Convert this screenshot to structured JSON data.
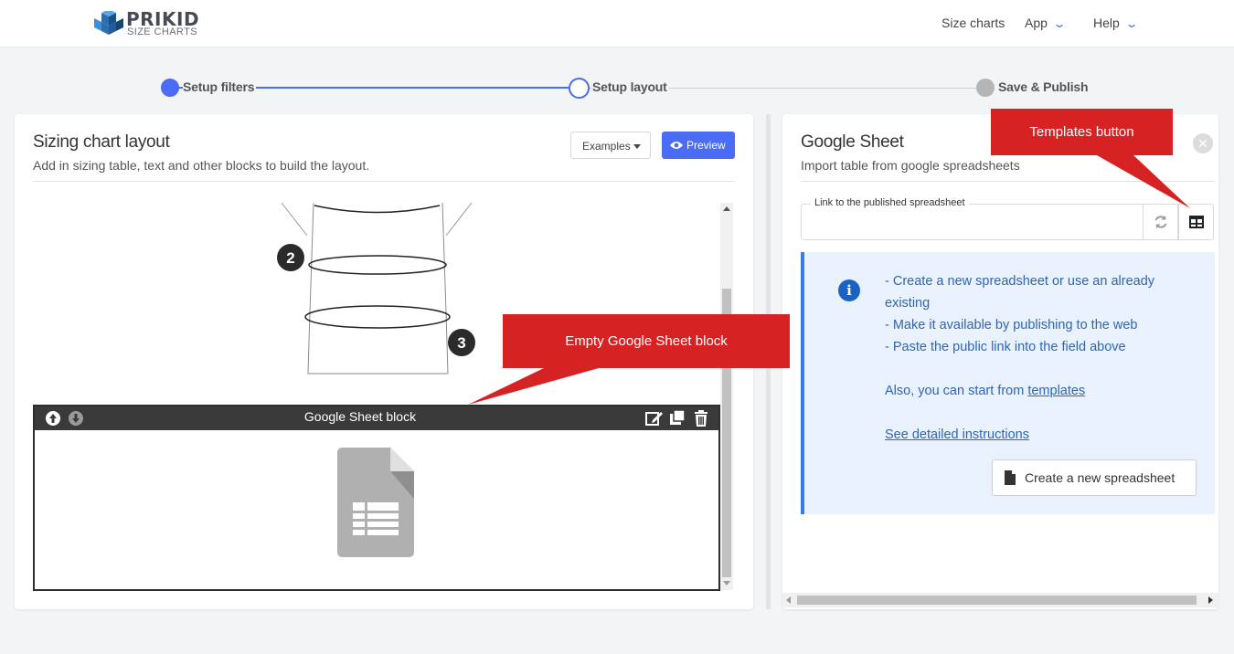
{
  "brand": {
    "name": "PRIKID",
    "tagline": "SIZE CHARTS"
  },
  "nav": {
    "size_charts": "Size charts",
    "app": "App",
    "help": "Help"
  },
  "stepper": {
    "steps": [
      {
        "label": "Setup filters",
        "state": "completed"
      },
      {
        "label": "Setup layout",
        "state": "current"
      },
      {
        "label": "Save & Publish",
        "state": "pending"
      }
    ],
    "colors": {
      "active": "#4a6cf7",
      "inactive": "#b5b5b5"
    }
  },
  "left_panel": {
    "title": "Sizing chart layout",
    "subtitle": "Add in sizing table, text and other blocks to build the layout.",
    "examples_label": "Examples",
    "preview_label": "Preview",
    "illustration_markers": [
      "2",
      "3"
    ],
    "block": {
      "title": "Google Sheet block"
    }
  },
  "right_panel": {
    "title": "Google Sheet",
    "subtitle": "Import table from google spreadsheets",
    "field": {
      "label": "Link to the published spreadsheet",
      "value": "",
      "placeholder": ""
    },
    "info": {
      "line1": "- Create a new spreadsheet or use an already existing",
      "line2": "- Make it available by publishing to the web",
      "line3": "- Paste the public link into the field above",
      "templates_prefix": "Also, you can start from",
      "templates_link": "templates",
      "instructions_link": "See detailed instructions"
    },
    "create_button": "Create a new spreadsheet"
  },
  "callouts": {
    "templates": "Templates button",
    "empty_block": "Empty Google Sheet block",
    "color": "#d62222"
  }
}
